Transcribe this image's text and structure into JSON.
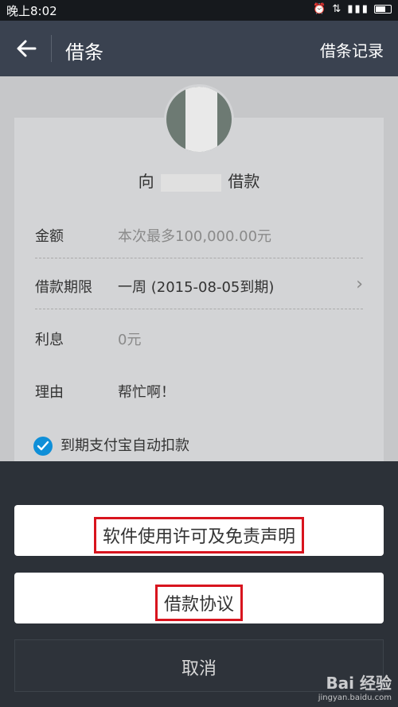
{
  "status": {
    "time": "晚上8:02",
    "icons": "⏰ ⇅ ▮▮▮ "
  },
  "appbar": {
    "title": "借条",
    "record_label": "借条记录"
  },
  "lender": {
    "prefix": "向",
    "suffix": "借款"
  },
  "form": {
    "amount": {
      "label": "金额",
      "placeholder": "本次最多100,000.00元"
    },
    "term": {
      "label": "借款期限",
      "value": "一周 (2015-08-05到期)"
    },
    "interest": {
      "label": "利息",
      "value": "0元"
    },
    "reason": {
      "label": "理由",
      "value": "帮忙啊！"
    },
    "autopay": {
      "label": "到期支付宝自动扣款",
      "checked": true
    }
  },
  "sheet": {
    "options": [
      "软件使用许可及免责声明",
      "借款协议"
    ],
    "cancel_label": "取消"
  },
  "watermark": {
    "brand": "Bai 经验",
    "url": "jingyan.baidu.com"
  },
  "colors": {
    "accent": "#0f8fd8",
    "highlight": "#d8141e",
    "appbar": "#3a4250"
  }
}
